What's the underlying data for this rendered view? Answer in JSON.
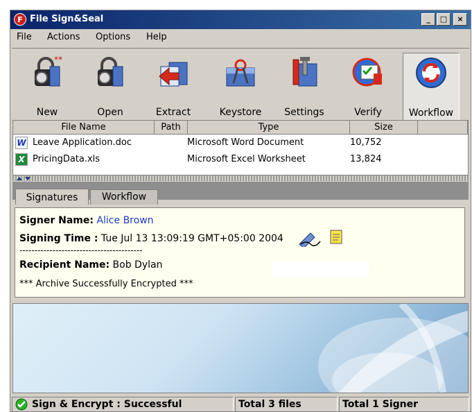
{
  "window": {
    "title": "File Sign&Seal",
    "app_icon_letter": "F",
    "minimize_glyph": "_",
    "maximize_glyph": "□",
    "close_glyph": "×"
  },
  "menu": [
    "File",
    "Actions",
    "Options",
    "Help"
  ],
  "toolbar": [
    {
      "label": "New",
      "icon": "new-lock-icon"
    },
    {
      "label": "Open",
      "icon": "open-lock-icon"
    },
    {
      "label": "Extract",
      "icon": "extract-icon"
    },
    {
      "label": "Keystore",
      "icon": "keystore-icon"
    },
    {
      "label": "Settings",
      "icon": "settings-icon"
    },
    {
      "label": "Verify",
      "icon": "verify-icon"
    },
    {
      "label": "Workflow",
      "icon": "workflow-icon",
      "active": true
    }
  ],
  "file_list": {
    "columns": [
      "File Name",
      "Path",
      "Type",
      "Size"
    ],
    "rows": [
      {
        "name": "Leave Application.doc",
        "path": "",
        "type": "Microsoft Word Document",
        "size": "10,752",
        "icon": "word-doc-icon",
        "icon_letter": "W"
      },
      {
        "name": "PricingData.xls",
        "path": "",
        "type": "Microsoft Excel Worksheet",
        "size": "13,824",
        "icon": "excel-doc-icon",
        "icon_letter": "X"
      }
    ]
  },
  "tabs": [
    "Signatures",
    "Workflow"
  ],
  "signature": {
    "signer_label": "Signer Name:",
    "signer_value": "Alice Brown",
    "time_label": "Signing Time :",
    "time_value": "Tue Jul 13 13:09:19 GMT+05:00 2004",
    "separator": "-----------------------------------------",
    "recipient_label": "Recipient Name:",
    "recipient_value": "Bob Dylan",
    "archive_status": "*** Archive Successfully Encrypted ***"
  },
  "status": {
    "message": "Sign & Encrypt : Successful",
    "files": "Total 3 files",
    "signers": "Total 1 Signer"
  },
  "colors": {
    "title_start": "#0a246a",
    "title_end": "#3a6ea5",
    "accent_blue": "#1a3ccf",
    "success_green": "#2bb32b"
  }
}
